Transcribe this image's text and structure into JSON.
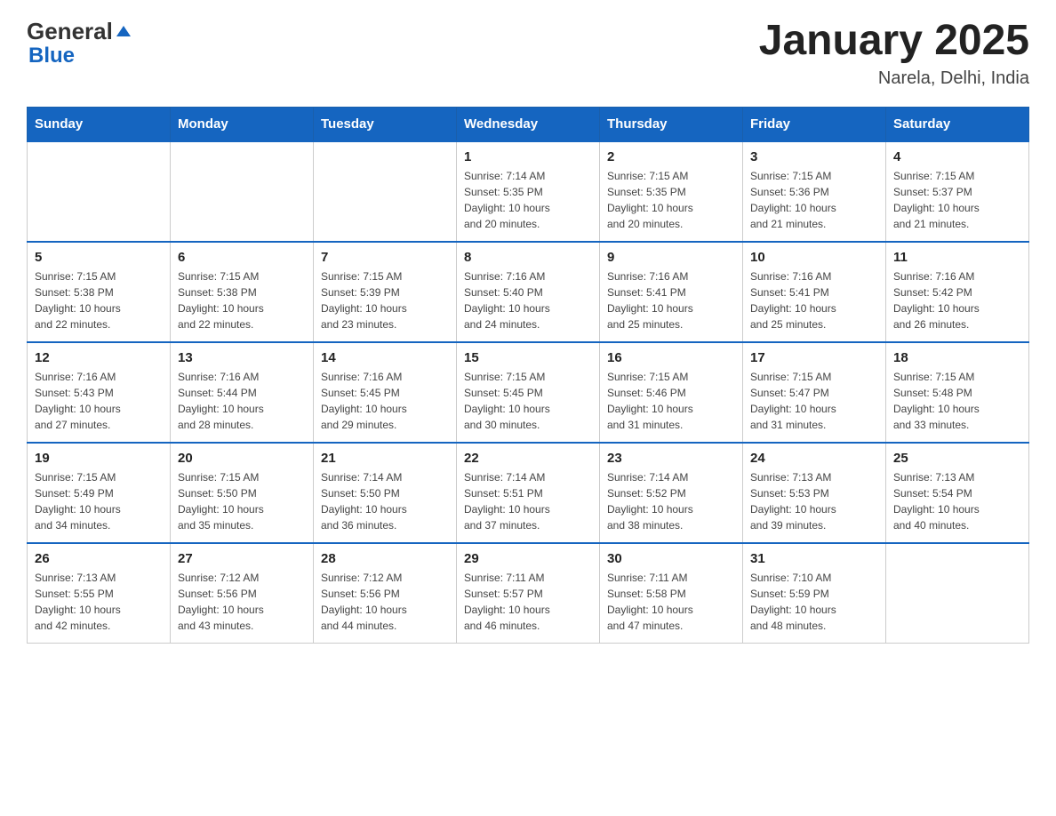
{
  "header": {
    "logo": {
      "general": "General",
      "arrow": "▶",
      "blue": "Blue"
    },
    "title": "January 2025",
    "subtitle": "Narela, Delhi, India"
  },
  "calendar": {
    "days_of_week": [
      "Sunday",
      "Monday",
      "Tuesday",
      "Wednesday",
      "Thursday",
      "Friday",
      "Saturday"
    ],
    "weeks": [
      [
        {
          "day": "",
          "info": ""
        },
        {
          "day": "",
          "info": ""
        },
        {
          "day": "",
          "info": ""
        },
        {
          "day": "1",
          "info": "Sunrise: 7:14 AM\nSunset: 5:35 PM\nDaylight: 10 hours\nand 20 minutes."
        },
        {
          "day": "2",
          "info": "Sunrise: 7:15 AM\nSunset: 5:35 PM\nDaylight: 10 hours\nand 20 minutes."
        },
        {
          "day": "3",
          "info": "Sunrise: 7:15 AM\nSunset: 5:36 PM\nDaylight: 10 hours\nand 21 minutes."
        },
        {
          "day": "4",
          "info": "Sunrise: 7:15 AM\nSunset: 5:37 PM\nDaylight: 10 hours\nand 21 minutes."
        }
      ],
      [
        {
          "day": "5",
          "info": "Sunrise: 7:15 AM\nSunset: 5:38 PM\nDaylight: 10 hours\nand 22 minutes."
        },
        {
          "day": "6",
          "info": "Sunrise: 7:15 AM\nSunset: 5:38 PM\nDaylight: 10 hours\nand 22 minutes."
        },
        {
          "day": "7",
          "info": "Sunrise: 7:15 AM\nSunset: 5:39 PM\nDaylight: 10 hours\nand 23 minutes."
        },
        {
          "day": "8",
          "info": "Sunrise: 7:16 AM\nSunset: 5:40 PM\nDaylight: 10 hours\nand 24 minutes."
        },
        {
          "day": "9",
          "info": "Sunrise: 7:16 AM\nSunset: 5:41 PM\nDaylight: 10 hours\nand 25 minutes."
        },
        {
          "day": "10",
          "info": "Sunrise: 7:16 AM\nSunset: 5:41 PM\nDaylight: 10 hours\nand 25 minutes."
        },
        {
          "day": "11",
          "info": "Sunrise: 7:16 AM\nSunset: 5:42 PM\nDaylight: 10 hours\nand 26 minutes."
        }
      ],
      [
        {
          "day": "12",
          "info": "Sunrise: 7:16 AM\nSunset: 5:43 PM\nDaylight: 10 hours\nand 27 minutes."
        },
        {
          "day": "13",
          "info": "Sunrise: 7:16 AM\nSunset: 5:44 PM\nDaylight: 10 hours\nand 28 minutes."
        },
        {
          "day": "14",
          "info": "Sunrise: 7:16 AM\nSunset: 5:45 PM\nDaylight: 10 hours\nand 29 minutes."
        },
        {
          "day": "15",
          "info": "Sunrise: 7:15 AM\nSunset: 5:45 PM\nDaylight: 10 hours\nand 30 minutes."
        },
        {
          "day": "16",
          "info": "Sunrise: 7:15 AM\nSunset: 5:46 PM\nDaylight: 10 hours\nand 31 minutes."
        },
        {
          "day": "17",
          "info": "Sunrise: 7:15 AM\nSunset: 5:47 PM\nDaylight: 10 hours\nand 31 minutes."
        },
        {
          "day": "18",
          "info": "Sunrise: 7:15 AM\nSunset: 5:48 PM\nDaylight: 10 hours\nand 33 minutes."
        }
      ],
      [
        {
          "day": "19",
          "info": "Sunrise: 7:15 AM\nSunset: 5:49 PM\nDaylight: 10 hours\nand 34 minutes."
        },
        {
          "day": "20",
          "info": "Sunrise: 7:15 AM\nSunset: 5:50 PM\nDaylight: 10 hours\nand 35 minutes."
        },
        {
          "day": "21",
          "info": "Sunrise: 7:14 AM\nSunset: 5:50 PM\nDaylight: 10 hours\nand 36 minutes."
        },
        {
          "day": "22",
          "info": "Sunrise: 7:14 AM\nSunset: 5:51 PM\nDaylight: 10 hours\nand 37 minutes."
        },
        {
          "day": "23",
          "info": "Sunrise: 7:14 AM\nSunset: 5:52 PM\nDaylight: 10 hours\nand 38 minutes."
        },
        {
          "day": "24",
          "info": "Sunrise: 7:13 AM\nSunset: 5:53 PM\nDaylight: 10 hours\nand 39 minutes."
        },
        {
          "day": "25",
          "info": "Sunrise: 7:13 AM\nSunset: 5:54 PM\nDaylight: 10 hours\nand 40 minutes."
        }
      ],
      [
        {
          "day": "26",
          "info": "Sunrise: 7:13 AM\nSunset: 5:55 PM\nDaylight: 10 hours\nand 42 minutes."
        },
        {
          "day": "27",
          "info": "Sunrise: 7:12 AM\nSunset: 5:56 PM\nDaylight: 10 hours\nand 43 minutes."
        },
        {
          "day": "28",
          "info": "Sunrise: 7:12 AM\nSunset: 5:56 PM\nDaylight: 10 hours\nand 44 minutes."
        },
        {
          "day": "29",
          "info": "Sunrise: 7:11 AM\nSunset: 5:57 PM\nDaylight: 10 hours\nand 46 minutes."
        },
        {
          "day": "30",
          "info": "Sunrise: 7:11 AM\nSunset: 5:58 PM\nDaylight: 10 hours\nand 47 minutes."
        },
        {
          "day": "31",
          "info": "Sunrise: 7:10 AM\nSunset: 5:59 PM\nDaylight: 10 hours\nand 48 minutes."
        },
        {
          "day": "",
          "info": ""
        }
      ]
    ]
  }
}
